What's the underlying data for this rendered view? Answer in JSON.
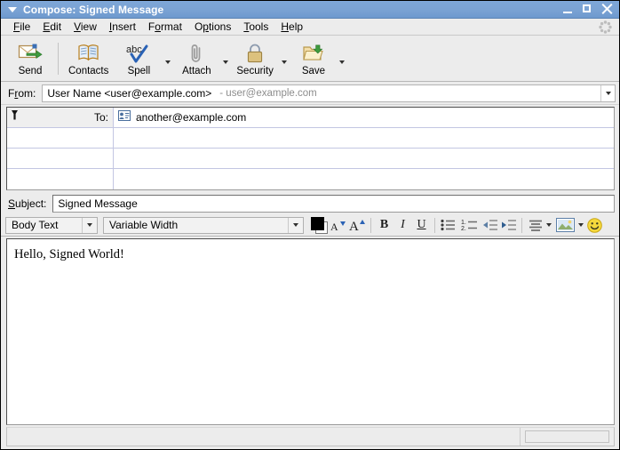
{
  "window": {
    "title": "Compose: Signed Message",
    "title_bg": "#7ba3d4",
    "menu_icon": "window-menu-chevron",
    "controls": [
      {
        "name": "minimize",
        "glyph": "minimize-icon"
      },
      {
        "name": "maximize",
        "glyph": "maximize-icon"
      },
      {
        "name": "close",
        "glyph": "close-icon"
      }
    ]
  },
  "menubar": {
    "items": [
      {
        "label": "File",
        "accel": "F"
      },
      {
        "label": "Edit",
        "accel": "E"
      },
      {
        "label": "View",
        "accel": "V"
      },
      {
        "label": "Insert",
        "accel": "I"
      },
      {
        "label": "Format",
        "accel": "o"
      },
      {
        "label": "Options",
        "accel": "p"
      },
      {
        "label": "Tools",
        "accel": "T"
      },
      {
        "label": "Help",
        "accel": "H"
      }
    ],
    "throbber": "activity-throbber-icon"
  },
  "toolbar": {
    "buttons": [
      {
        "label": "Send",
        "icon": "send-mail-icon",
        "has_menu": false
      },
      {
        "label": "Contacts",
        "icon": "contacts-book-icon",
        "has_menu": false
      },
      {
        "label": "Spell",
        "icon": "spell-check-icon",
        "has_menu": true
      },
      {
        "label": "Attach",
        "icon": "paperclip-icon",
        "has_menu": true
      },
      {
        "label": "Security",
        "icon": "padlock-icon",
        "has_menu": true
      },
      {
        "label": "Save",
        "icon": "save-folder-icon",
        "has_menu": true
      }
    ]
  },
  "from": {
    "label": "From:",
    "accel": "r",
    "identity": "User Name <user@example.com>",
    "address_hint": "- user@example.com",
    "dropdown": "chevron-down-icon"
  },
  "addressing": {
    "rows": [
      {
        "type": "To:",
        "value": "another@example.com",
        "icon": "address-card-icon",
        "empty": false
      },
      {
        "type": "",
        "value": "",
        "icon": "",
        "empty": true
      },
      {
        "type": "",
        "value": "",
        "icon": "",
        "empty": true
      },
      {
        "type": "",
        "value": "",
        "icon": "",
        "empty": true
      }
    ],
    "type_menu_icon": "recipient-type-menu-icon"
  },
  "subject": {
    "label": "Subject:",
    "accel": "S",
    "value": "Signed Message",
    "placeholder": ""
  },
  "formatbar": {
    "paragraph_style": "Body Text",
    "font_family": "Variable Width",
    "text_color": "#000000",
    "background_color": "#ffffff",
    "buttons": [
      {
        "name": "decrease-font-size",
        "label": "A",
        "icon": "decrease-font-size-icon"
      },
      {
        "name": "increase-font-size",
        "label": "A",
        "icon": "increase-font-size-icon"
      },
      {
        "name": "bold",
        "label": "B",
        "icon": "bold-icon"
      },
      {
        "name": "italic",
        "label": "I",
        "icon": "italic-icon"
      },
      {
        "name": "underline",
        "label": "U",
        "icon": "underline-icon"
      },
      {
        "name": "bullet-list",
        "label": "",
        "icon": "bullet-list-icon"
      },
      {
        "name": "numbered-list",
        "label": "",
        "icon": "numbered-list-icon"
      },
      {
        "name": "outdent",
        "label": "",
        "icon": "outdent-icon"
      },
      {
        "name": "indent",
        "label": "",
        "icon": "indent-icon"
      },
      {
        "name": "align",
        "label": "",
        "icon": "align-left-icon"
      },
      {
        "name": "insert-image",
        "label": "",
        "icon": "insert-image-icon"
      },
      {
        "name": "insert-smiley",
        "label": "",
        "icon": "smiley-face-icon"
      }
    ]
  },
  "body": {
    "text": "Hello, Signed World!"
  },
  "statusbar": {
    "text": "",
    "progress": ""
  }
}
